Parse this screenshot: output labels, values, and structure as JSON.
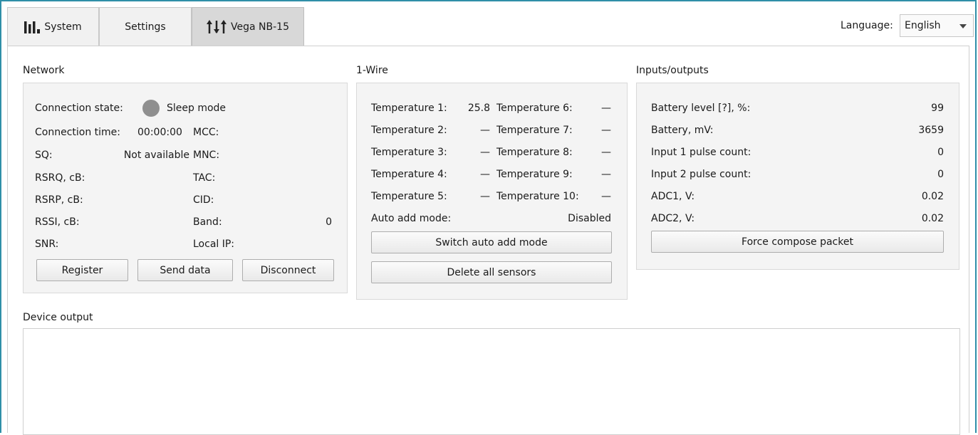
{
  "tabs": [
    {
      "label": "System",
      "icon": "bar-chart-icon"
    },
    {
      "label": "Settings"
    },
    {
      "label": "Vega NB-15",
      "icon": "sliders-icon"
    }
  ],
  "language": {
    "label": "Language:",
    "value": "English"
  },
  "network": {
    "title": "Network",
    "connection_state_label": "Connection state:",
    "connection_state_value": "Sleep mode",
    "status_dot_color": "#8f8f8f",
    "connection_time_label": "Connection time:",
    "connection_time_value": "00:00:00",
    "sq_label": "SQ:",
    "sq_value": "Not available",
    "rsrq_label": "RSRQ, cB:",
    "rsrp_label": "RSRP, cB:",
    "rssi_label": "RSSI, cB:",
    "snr_label": "SNR:",
    "mcc_label": "MCC:",
    "mnc_label": "MNC:",
    "tac_label": "TAC:",
    "cid_label": "CID:",
    "band_label": "Band:",
    "band_value": "0",
    "local_ip_label": "Local IP:",
    "register_btn": "Register",
    "send_data_btn": "Send data",
    "disconnect_btn": "Disconnect"
  },
  "onewire": {
    "title": "1-Wire",
    "left": [
      {
        "label": "Temperature 1:",
        "value": "25.8"
      },
      {
        "label": "Temperature 2:",
        "value": "—"
      },
      {
        "label": "Temperature 3:",
        "value": "—"
      },
      {
        "label": "Temperature 4:",
        "value": "—"
      },
      {
        "label": "Temperature 5:",
        "value": "—"
      }
    ],
    "right": [
      {
        "label": "Temperature 6:",
        "value": "—"
      },
      {
        "label": "Temperature 7:",
        "value": "—"
      },
      {
        "label": "Temperature 8:",
        "value": "—"
      },
      {
        "label": "Temperature 9:",
        "value": "—"
      },
      {
        "label": "Temperature 10:",
        "value": "—"
      }
    ],
    "auto_add_label": "Auto add mode:",
    "auto_add_value": "Disabled",
    "switch_btn": "Switch auto add mode",
    "delete_btn": "Delete all sensors"
  },
  "io": {
    "title": "Inputs/outputs",
    "rows": [
      {
        "label": "Battery level [?], %:",
        "value": "99"
      },
      {
        "label": "Battery, mV:",
        "value": "3659"
      },
      {
        "label": "Input 1 pulse count:",
        "value": "0"
      },
      {
        "label": "Input 2 pulse count:",
        "value": "0"
      },
      {
        "label": "ADC1, V:",
        "value": "0.02"
      },
      {
        "label": "ADC2, V:",
        "value": "0.02"
      }
    ],
    "force_btn": "Force compose packet"
  },
  "device_output": {
    "title": "Device output"
  }
}
